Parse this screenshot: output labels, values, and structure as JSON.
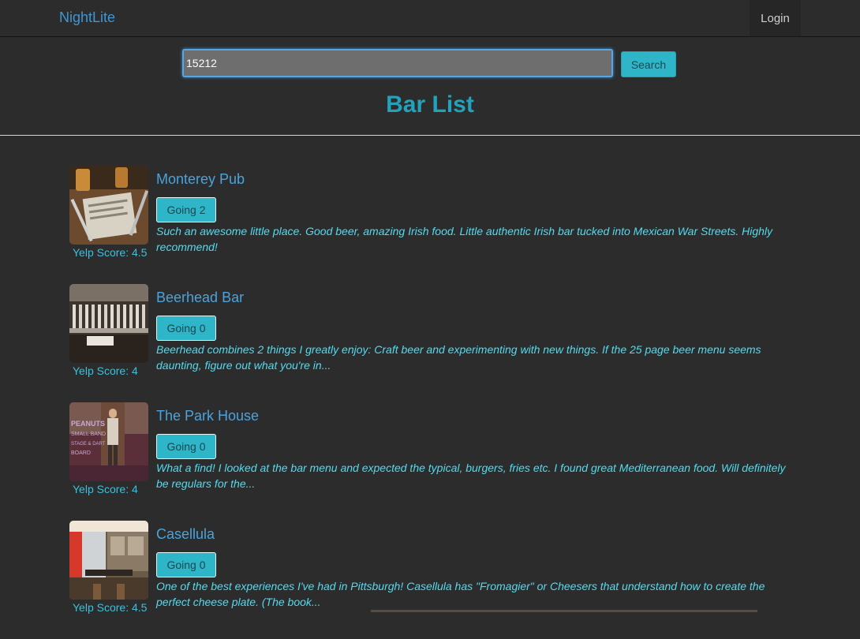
{
  "navbar": {
    "brand": "NightLite",
    "login_label": "Login"
  },
  "search": {
    "value": "15212",
    "button_label": "Search"
  },
  "page_title": "Bar List",
  "bars": [
    {
      "name": "Monterey Pub",
      "going_label": "Going 2",
      "description": "Such an awesome little place. Good beer, amazing Irish food. Little authentic Irish bar tucked into Mexican War Streets. Highly recommend!",
      "score_label": "Yelp Score: 4.5"
    },
    {
      "name": "Beerhead Bar",
      "going_label": "Going 0",
      "description": "Beerhead combines 2 things I greatly enjoy: Craft beer and experimenting with new things. If the 25 page beer menu seems daunting, figure out what you're in...",
      "score_label": "Yelp Score: 4"
    },
    {
      "name": "The Park House",
      "going_label": "Going 0",
      "description": "What a find! I looked at the bar menu and expected the typical, burgers, fries etc. I found great Mediterranean food. Will definitely be regulars for the...",
      "score_label": "Yelp Score: 4",
      "photo_text": [
        "PEANUTS",
        "SMALL BAND",
        "STAGE & DART",
        "BOARD"
      ]
    },
    {
      "name": "Casellula",
      "going_label": "Going 0",
      "description": "One of the best experiences I've had in Pittsburgh! Casellula has \"Fromagier\" or Cheesers that understand how to create the perfect cheese plate. (The book...",
      "score_label": "Yelp Score: 4.5"
    }
  ]
}
